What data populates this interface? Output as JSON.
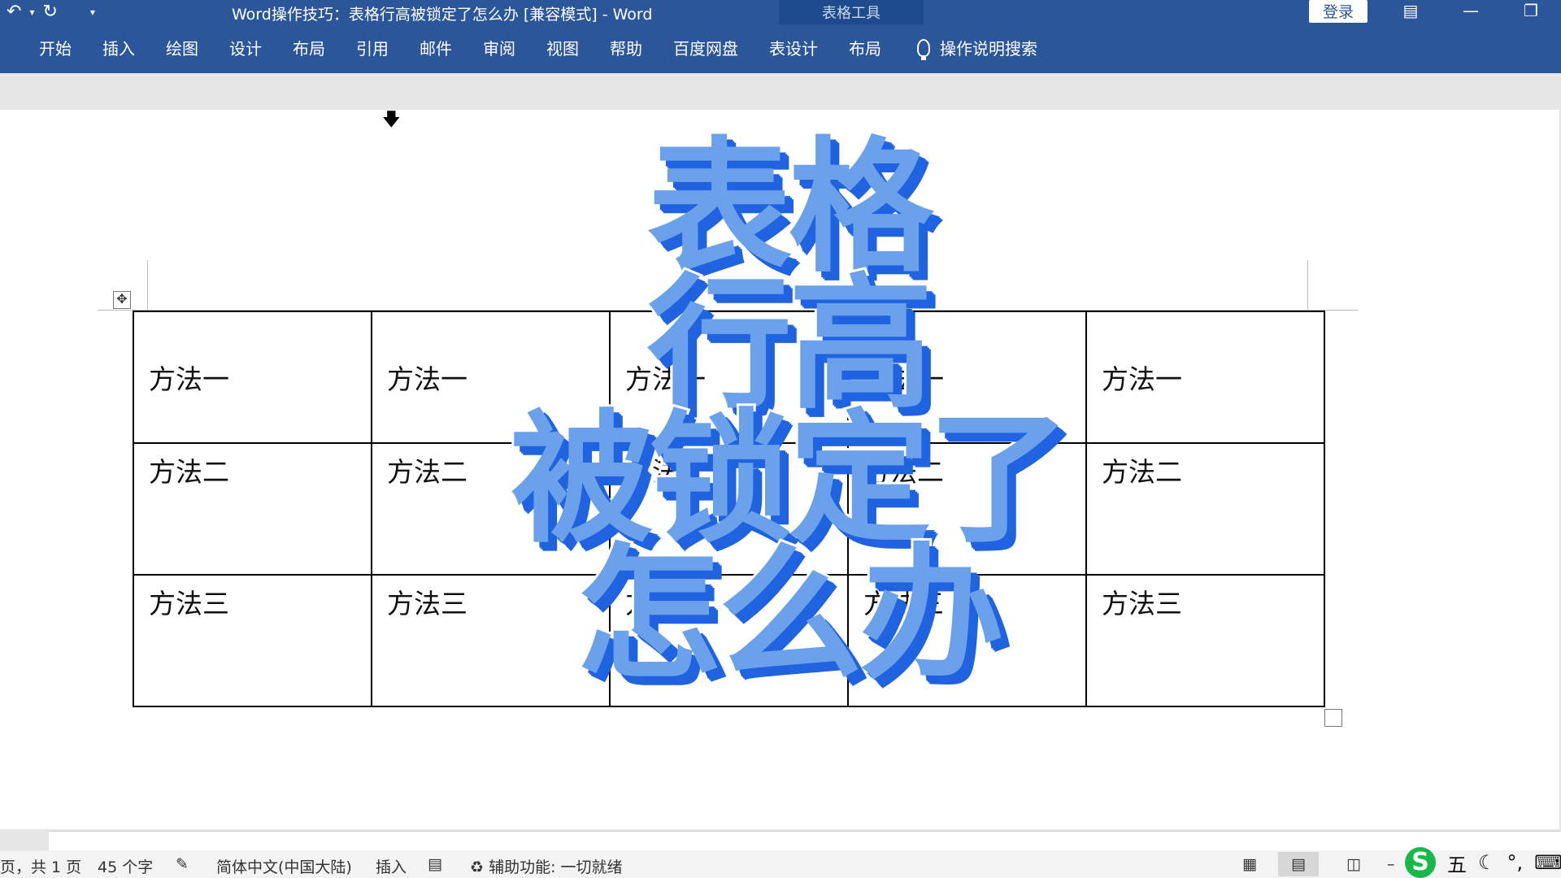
{
  "window": {
    "title": "Word操作技巧：表格行高被锁定了怎么办 [兼容模式]  -  Word",
    "context_group": "表格工具",
    "login": "登录"
  },
  "ribbon": {
    "tabs": [
      "开始",
      "插入",
      "绘图",
      "设计",
      "布局",
      "引用",
      "邮件",
      "审阅",
      "视图",
      "帮助",
      "百度网盘"
    ],
    "context_tabs": [
      "表设计",
      "布局"
    ],
    "tell_me": "操作说明搜索"
  },
  "table": {
    "rows": [
      [
        "方法一",
        "方法一",
        "方法一",
        "方法一",
        "方法一"
      ],
      [
        "方法二",
        "方法二",
        "方法二",
        "方法二",
        "方法二"
      ],
      [
        "方法三",
        "方法三",
        "方法三",
        "方法三",
        "方法三"
      ]
    ]
  },
  "overlay": {
    "lines": [
      "表格",
      "行高",
      "被锁定了",
      "怎么办"
    ],
    "fill_color": "#6aa1ea",
    "shadow_color": "#1f63e0"
  },
  "status": {
    "page": "页，共 1 页",
    "words": "45 个字",
    "language": "简体中文(中国大陆)",
    "mode": "插入",
    "accessibility": "辅助功能: 一切就绪"
  },
  "ime": {
    "logo": "S",
    "mode": "五"
  },
  "icons": {
    "undo": "undo-icon",
    "redo": "redo-icon",
    "customize": "customize-qat-icon",
    "ribbon_display": "ribbon-display-icon",
    "minimize": "minimize-icon",
    "restore": "restore-icon",
    "tell_me": "lightbulb-icon"
  }
}
